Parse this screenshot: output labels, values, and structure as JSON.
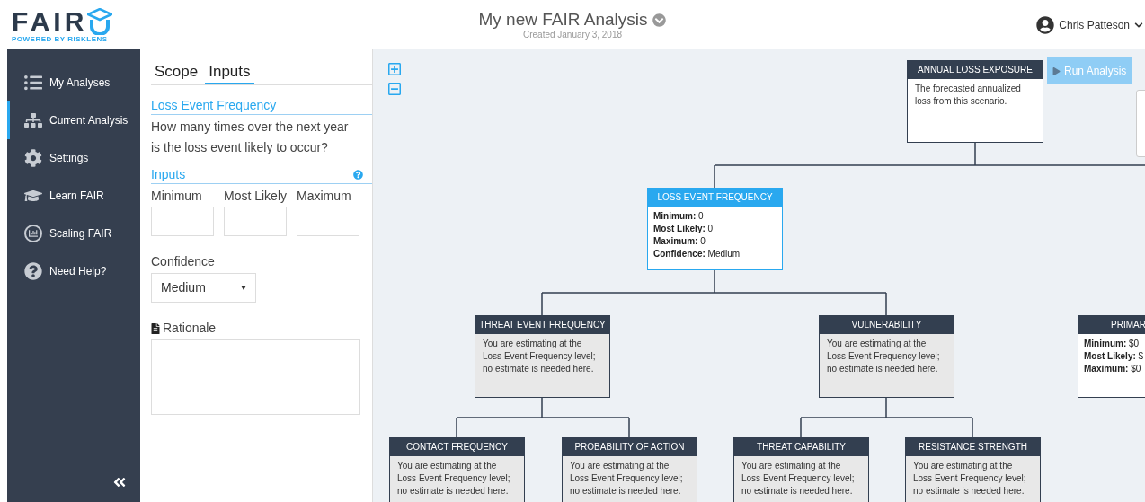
{
  "header": {
    "logo": "FAIR",
    "logo_tagline": "POWERED BY RISKLENS",
    "title": "My new FAIR Analysis",
    "subtitle": "Created January 3, 2018",
    "user": "Chris Patteson"
  },
  "sidebar": {
    "items": [
      {
        "label": "My Analyses",
        "selected": false
      },
      {
        "label": "Current Analysis",
        "selected": true
      },
      {
        "label": "Settings",
        "selected": false
      },
      {
        "label": "Learn FAIR",
        "selected": false
      },
      {
        "label": "Scaling FAIR",
        "selected": false
      },
      {
        "label": "Need Help?",
        "selected": false
      }
    ]
  },
  "panel": {
    "tabs": [
      {
        "label": "Scope",
        "selected": false
      },
      {
        "label": "Inputs",
        "selected": true
      }
    ],
    "section_title": "Loss Event Frequency",
    "question": "How many times over the next year is the loss event likely to occur?",
    "inputs_title": "Inputs",
    "fields": [
      {
        "label": "Minimum"
      },
      {
        "label": "Most Likely"
      },
      {
        "label": "Maximum"
      }
    ],
    "confidence": {
      "label": "Confidence",
      "value": "Medium"
    },
    "rationale": {
      "label": "Rationale"
    }
  },
  "diagram": {
    "run_button": "Run Analysis",
    "nodes": [
      {
        "title": "ANNUAL LOSS EXPOSURE",
        "selected": false,
        "disabled": false,
        "body": "The forecasted annualized loss from this scenario."
      },
      {
        "title": "LOSS EVENT FREQUENCY",
        "selected": true,
        "disabled": false,
        "lines": [
          "**Minimum:** 0",
          "**Most Likely:** 0",
          "**Maximum:** 0",
          "**Confidence:** Medium"
        ]
      },
      {
        "title": "THREAT EVENT FREQUENCY",
        "selected": false,
        "disabled": true,
        "body": "You are estimating at the Loss Event Frequency level; no estimate is needed here."
      },
      {
        "title": "VULNERABILITY",
        "selected": false,
        "disabled": true,
        "body": "You are estimating at the Loss Event Frequency level; no estimate is needed here."
      },
      {
        "title": "PRIMAR",
        "selected": false,
        "disabled": false,
        "lines": [
          "**Minimum:** $0",
          "**Most Likely:** $",
          "**Maximum:** $0"
        ]
      },
      {
        "title": "CONTACT FREQUENCY",
        "selected": false,
        "disabled": true,
        "body": "You are estimating at the Loss Event Frequency level; no estimate is needed here."
      },
      {
        "title": "PROBABILITY OF ACTION",
        "selected": false,
        "disabled": true,
        "body": "You are estimating at the Loss Event Frequency level; no estimate is needed here."
      },
      {
        "title": "THREAT CAPABILITY",
        "selected": false,
        "disabled": true,
        "body": "You are estimating at the Loss Event Frequency level; no estimate is needed here."
      },
      {
        "title": "RESISTANCE STRENGTH",
        "selected": false,
        "disabled": true,
        "body": "You are estimating at the Loss Event Frequency level; no estimate is needed here."
      }
    ]
  }
}
